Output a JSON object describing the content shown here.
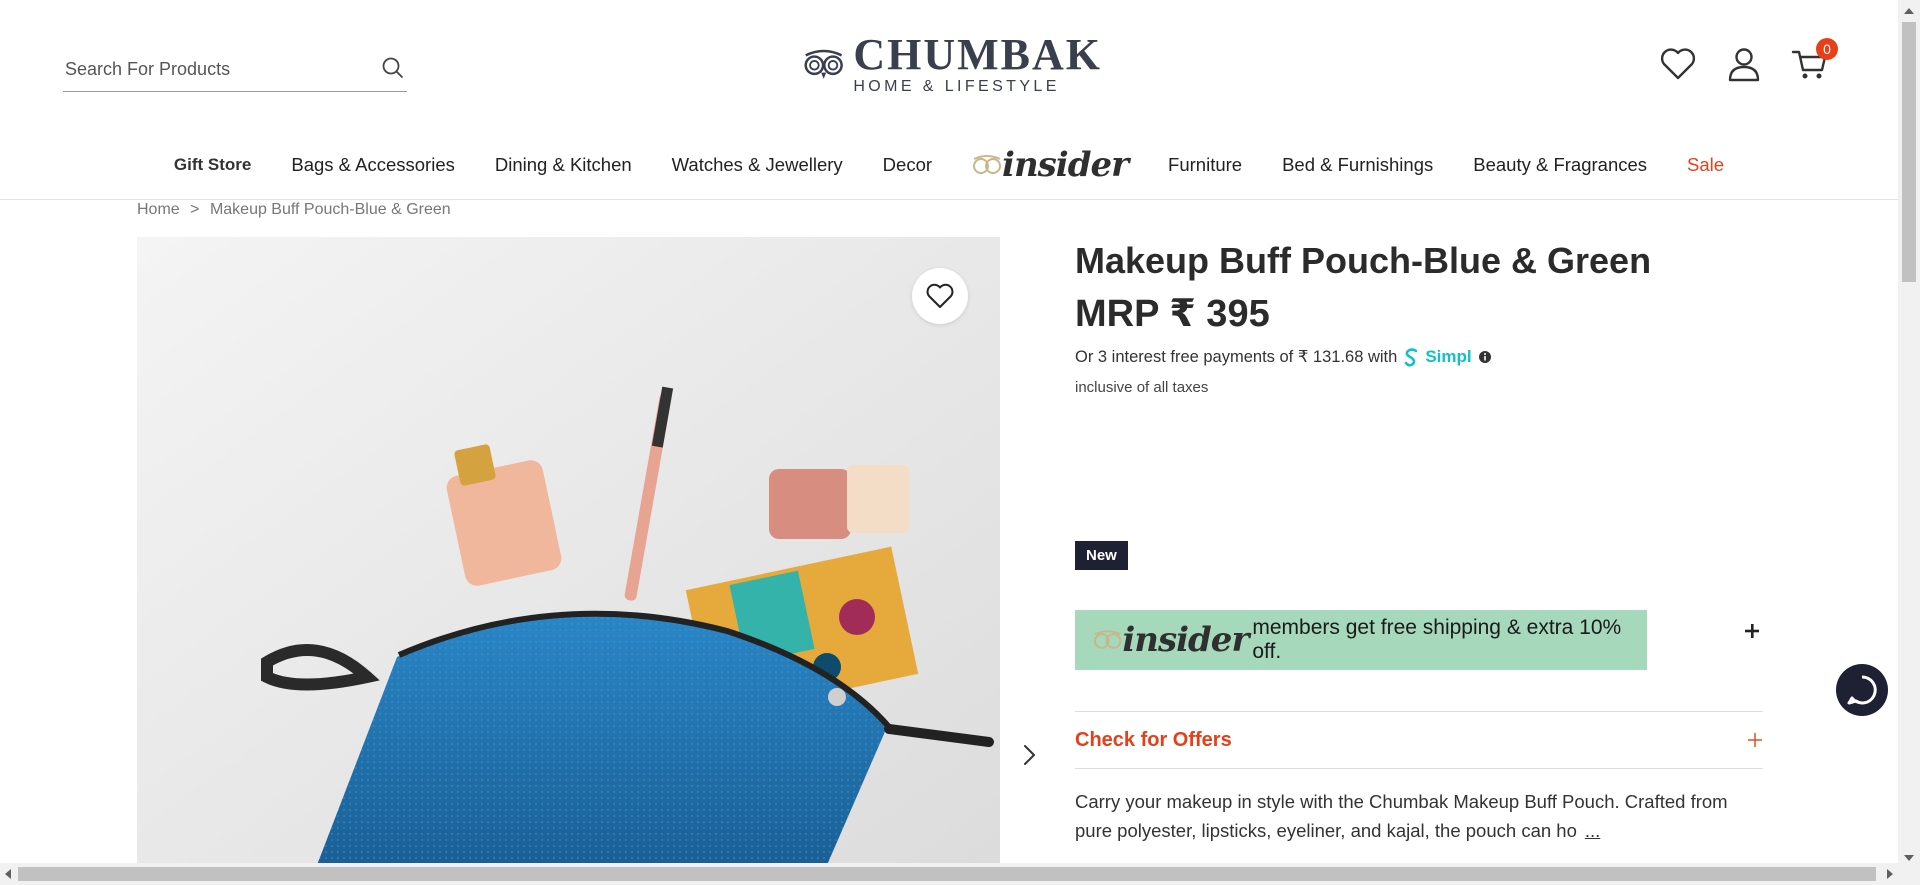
{
  "search": {
    "placeholder": "Search For Products"
  },
  "logo": {
    "title": "CHUMBAK",
    "subtitle": "HOME & LIFESTYLE"
  },
  "header": {
    "cart_count": "0"
  },
  "nav": {
    "gift": "Gift Store",
    "items": [
      "Bags & Accessories",
      "Dining & Kitchen",
      "Watches & Jewellery",
      "Decor"
    ],
    "insider": "insider",
    "items2": [
      "Furniture",
      "Bed & Furnishings",
      "Beauty & Fragrances"
    ],
    "sale": "Sale"
  },
  "breadcrumb": {
    "home": "Home",
    "separator": ">",
    "current": "Makeup Buff Pouch-Blue & Green"
  },
  "product": {
    "title": "Makeup Buff Pouch-Blue & Green",
    "price": "MRP ₹ 395",
    "payment_text": "Or 3 interest free payments of ₹ 131.68 with",
    "simpl_label": "Simpl",
    "taxes": "inclusive of all taxes",
    "badge": "New",
    "insider_banner_word": "insider",
    "insider_banner_text": "members get free shipping & extra 10% off.",
    "offers_label": "Check for Offers",
    "description": "Carry your makeup in style with the Chumbak Makeup Buff Pouch. Crafted from pure polyester, lipsticks, eyeliner, and kajal, the pouch can ho",
    "more": "..."
  },
  "colors": {
    "accent": "#e5401a",
    "dark": "#1e2033",
    "insider_green": "#a6d8bc",
    "simpl": "#12c0c9"
  },
  "icons": [
    "search-icon",
    "heart-icon",
    "user-icon",
    "cart-icon",
    "chevron-right-icon",
    "info-icon",
    "chat-icon",
    "plus-icon"
  ]
}
